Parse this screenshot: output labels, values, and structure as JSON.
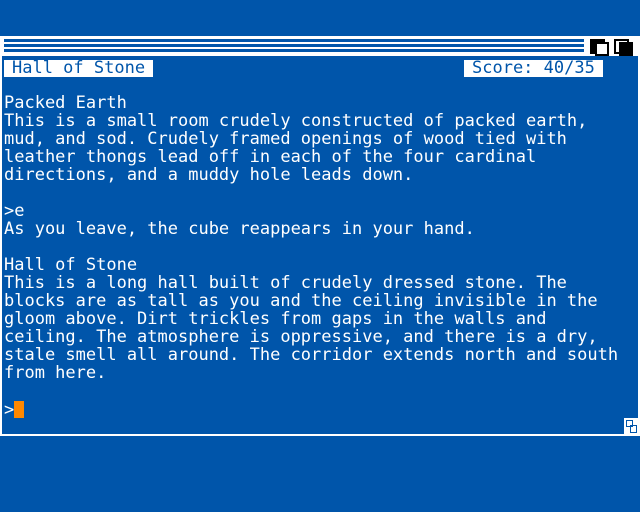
{
  "window": {
    "location": "Hall of Stone",
    "score": "Score: 40/35"
  },
  "transcript": [
    "Packed Earth",
    "This is a small room crudely constructed of packed earth,",
    "mud, and sod. Crudely framed openings of wood tied with",
    "leather thongs lead off in each of the four cardinal",
    "directions, and a muddy hole leads down.",
    "",
    ">e",
    "As you leave, the cube reappears in your hand.",
    "",
    "Hall of Stone",
    "This is a long hall built of crudely dressed stone. The",
    "blocks are as tall as you and the ceiling invisible in the",
    "gloom above. Dirt trickles from gaps in the walls and",
    "ceiling. The atmosphere is oppressive, and there is a dry,",
    "stale smell all around. The corridor extends north and south",
    "from here."
  ],
  "prompt": ">",
  "colors": {
    "background": "#0055aa",
    "text": "#ffffff",
    "cursor": "#ff8800"
  }
}
